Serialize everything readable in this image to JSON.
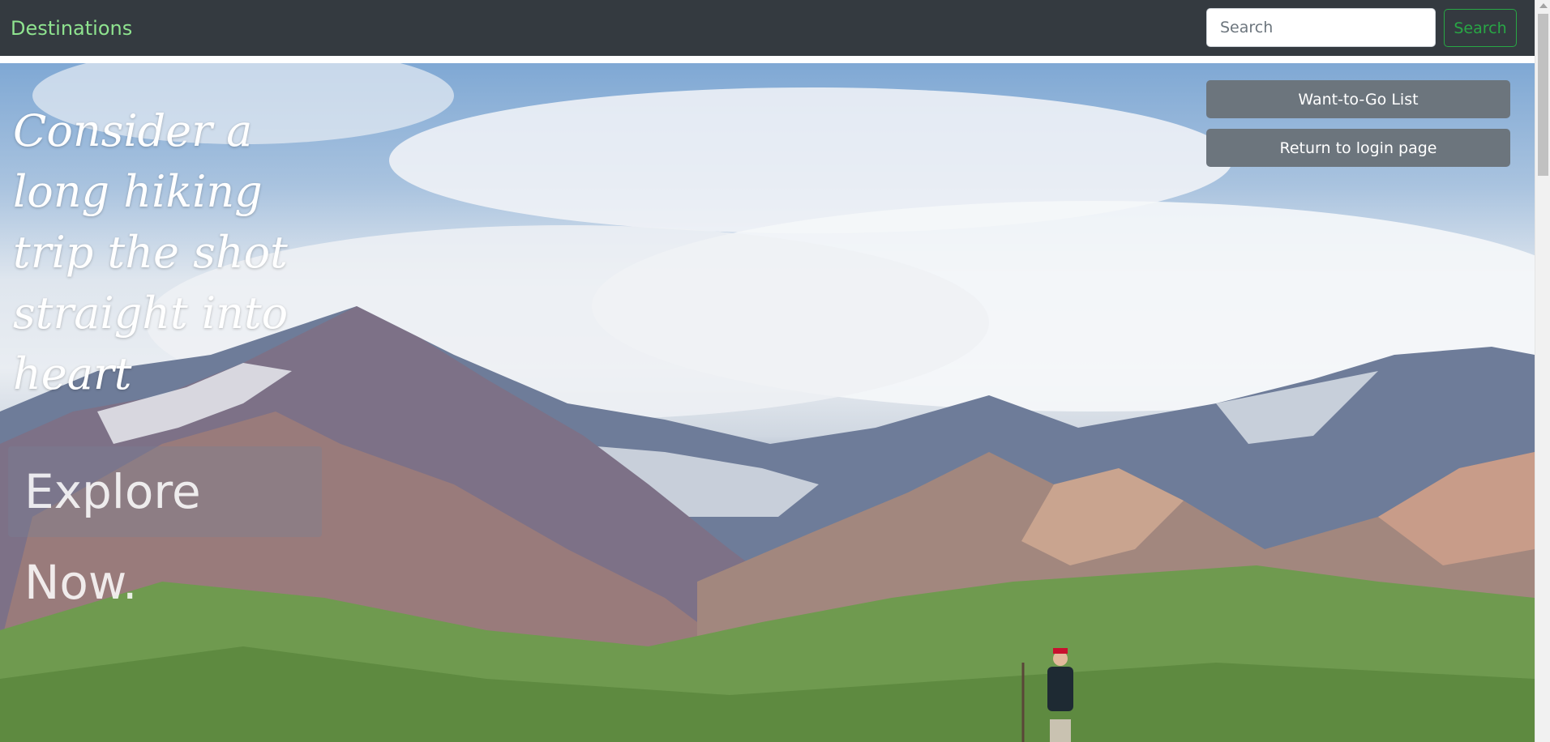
{
  "navbar": {
    "brand": "Destinations",
    "search_placeholder": "Search",
    "search_button": "Search"
  },
  "hero": {
    "tagline": "Consider a long hiking trip the shot straight into heart",
    "explore_button": "Explore Now.",
    "wanttogo_button": "Want-to-Go List",
    "return_button": "Return to login page"
  },
  "colors": {
    "navbar_bg": "#343a40",
    "brand": "#8fe38f",
    "search_button": "#28a745",
    "side_button_bg": "#6c757d"
  }
}
